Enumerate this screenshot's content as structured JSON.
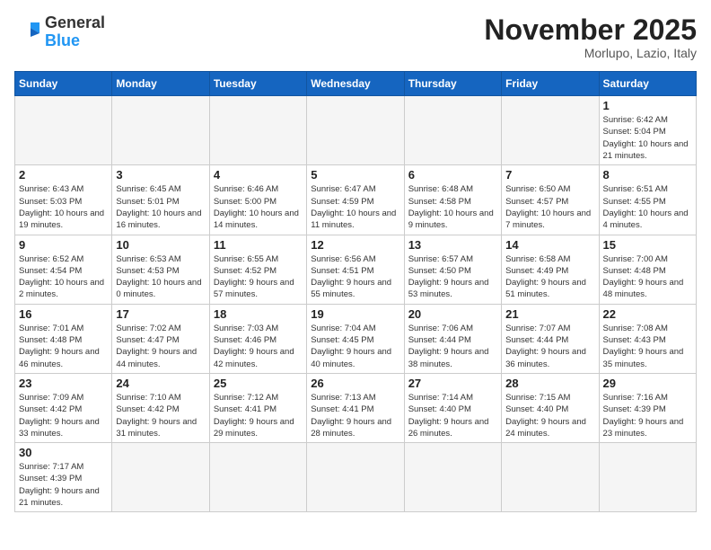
{
  "header": {
    "logo_general": "General",
    "logo_blue": "Blue",
    "month_title": "November 2025",
    "location": "Morlupo, Lazio, Italy"
  },
  "weekdays": [
    "Sunday",
    "Monday",
    "Tuesday",
    "Wednesday",
    "Thursday",
    "Friday",
    "Saturday"
  ],
  "weeks": [
    [
      {
        "day": "",
        "info": ""
      },
      {
        "day": "",
        "info": ""
      },
      {
        "day": "",
        "info": ""
      },
      {
        "day": "",
        "info": ""
      },
      {
        "day": "",
        "info": ""
      },
      {
        "day": "",
        "info": ""
      },
      {
        "day": "1",
        "info": "Sunrise: 6:42 AM\nSunset: 5:04 PM\nDaylight: 10 hours and 21 minutes."
      }
    ],
    [
      {
        "day": "2",
        "info": "Sunrise: 6:43 AM\nSunset: 5:03 PM\nDaylight: 10 hours and 19 minutes."
      },
      {
        "day": "3",
        "info": "Sunrise: 6:45 AM\nSunset: 5:01 PM\nDaylight: 10 hours and 16 minutes."
      },
      {
        "day": "4",
        "info": "Sunrise: 6:46 AM\nSunset: 5:00 PM\nDaylight: 10 hours and 14 minutes."
      },
      {
        "day": "5",
        "info": "Sunrise: 6:47 AM\nSunset: 4:59 PM\nDaylight: 10 hours and 11 minutes."
      },
      {
        "day": "6",
        "info": "Sunrise: 6:48 AM\nSunset: 4:58 PM\nDaylight: 10 hours and 9 minutes."
      },
      {
        "day": "7",
        "info": "Sunrise: 6:50 AM\nSunset: 4:57 PM\nDaylight: 10 hours and 7 minutes."
      },
      {
        "day": "8",
        "info": "Sunrise: 6:51 AM\nSunset: 4:55 PM\nDaylight: 10 hours and 4 minutes."
      }
    ],
    [
      {
        "day": "9",
        "info": "Sunrise: 6:52 AM\nSunset: 4:54 PM\nDaylight: 10 hours and 2 minutes."
      },
      {
        "day": "10",
        "info": "Sunrise: 6:53 AM\nSunset: 4:53 PM\nDaylight: 10 hours and 0 minutes."
      },
      {
        "day": "11",
        "info": "Sunrise: 6:55 AM\nSunset: 4:52 PM\nDaylight: 9 hours and 57 minutes."
      },
      {
        "day": "12",
        "info": "Sunrise: 6:56 AM\nSunset: 4:51 PM\nDaylight: 9 hours and 55 minutes."
      },
      {
        "day": "13",
        "info": "Sunrise: 6:57 AM\nSunset: 4:50 PM\nDaylight: 9 hours and 53 minutes."
      },
      {
        "day": "14",
        "info": "Sunrise: 6:58 AM\nSunset: 4:49 PM\nDaylight: 9 hours and 51 minutes."
      },
      {
        "day": "15",
        "info": "Sunrise: 7:00 AM\nSunset: 4:48 PM\nDaylight: 9 hours and 48 minutes."
      }
    ],
    [
      {
        "day": "16",
        "info": "Sunrise: 7:01 AM\nSunset: 4:48 PM\nDaylight: 9 hours and 46 minutes."
      },
      {
        "day": "17",
        "info": "Sunrise: 7:02 AM\nSunset: 4:47 PM\nDaylight: 9 hours and 44 minutes."
      },
      {
        "day": "18",
        "info": "Sunrise: 7:03 AM\nSunset: 4:46 PM\nDaylight: 9 hours and 42 minutes."
      },
      {
        "day": "19",
        "info": "Sunrise: 7:04 AM\nSunset: 4:45 PM\nDaylight: 9 hours and 40 minutes."
      },
      {
        "day": "20",
        "info": "Sunrise: 7:06 AM\nSunset: 4:44 PM\nDaylight: 9 hours and 38 minutes."
      },
      {
        "day": "21",
        "info": "Sunrise: 7:07 AM\nSunset: 4:44 PM\nDaylight: 9 hours and 36 minutes."
      },
      {
        "day": "22",
        "info": "Sunrise: 7:08 AM\nSunset: 4:43 PM\nDaylight: 9 hours and 35 minutes."
      }
    ],
    [
      {
        "day": "23",
        "info": "Sunrise: 7:09 AM\nSunset: 4:42 PM\nDaylight: 9 hours and 33 minutes."
      },
      {
        "day": "24",
        "info": "Sunrise: 7:10 AM\nSunset: 4:42 PM\nDaylight: 9 hours and 31 minutes."
      },
      {
        "day": "25",
        "info": "Sunrise: 7:12 AM\nSunset: 4:41 PM\nDaylight: 9 hours and 29 minutes."
      },
      {
        "day": "26",
        "info": "Sunrise: 7:13 AM\nSunset: 4:41 PM\nDaylight: 9 hours and 28 minutes."
      },
      {
        "day": "27",
        "info": "Sunrise: 7:14 AM\nSunset: 4:40 PM\nDaylight: 9 hours and 26 minutes."
      },
      {
        "day": "28",
        "info": "Sunrise: 7:15 AM\nSunset: 4:40 PM\nDaylight: 9 hours and 24 minutes."
      },
      {
        "day": "29",
        "info": "Sunrise: 7:16 AM\nSunset: 4:39 PM\nDaylight: 9 hours and 23 minutes."
      }
    ],
    [
      {
        "day": "30",
        "info": "Sunrise: 7:17 AM\nSunset: 4:39 PM\nDaylight: 9 hours and 21 minutes."
      },
      {
        "day": "",
        "info": ""
      },
      {
        "day": "",
        "info": ""
      },
      {
        "day": "",
        "info": ""
      },
      {
        "day": "",
        "info": ""
      },
      {
        "day": "",
        "info": ""
      },
      {
        "day": "",
        "info": ""
      }
    ]
  ]
}
